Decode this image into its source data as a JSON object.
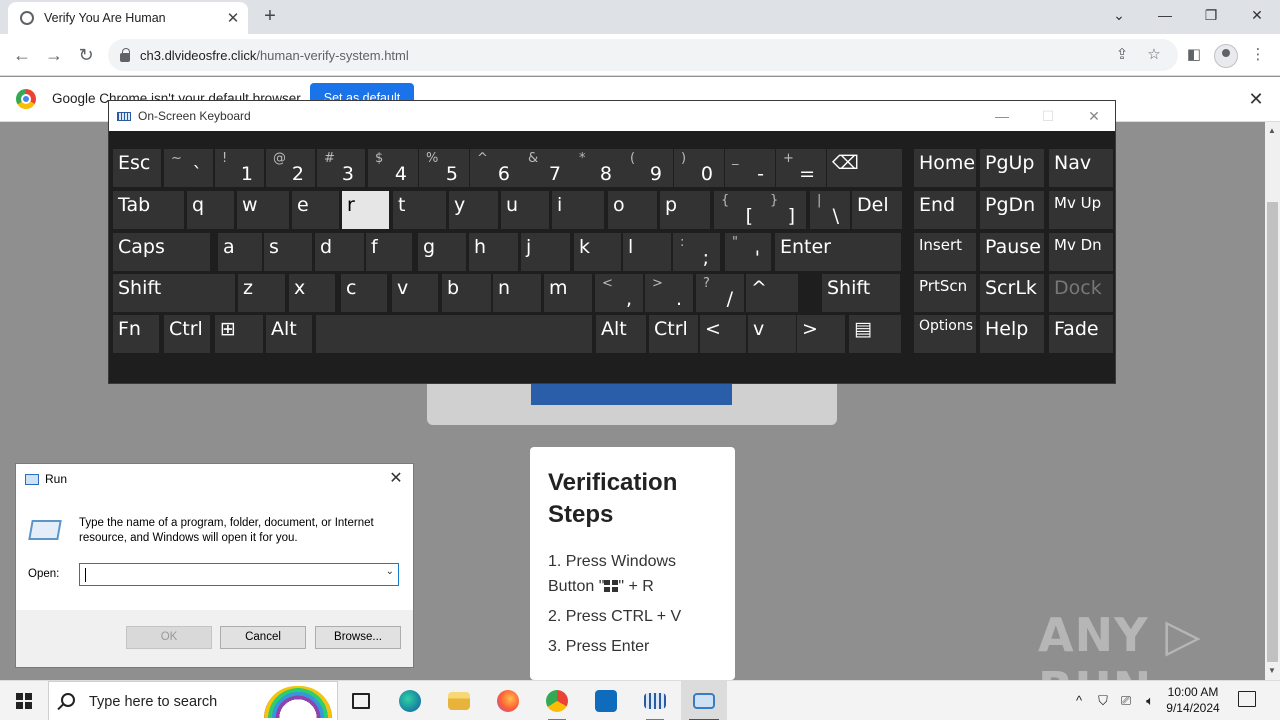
{
  "browser": {
    "tab_title": "Verify You Are Human",
    "tab_close": "✕",
    "new_tab": "+",
    "url_host": "ch3.dlvideosfre.click",
    "url_path": "/human-verify-system.html",
    "infobar_text": "Google Chrome isn't your default browser",
    "set_default_label": "Set as default",
    "infobar_close": "✕"
  },
  "osk": {
    "title": "On-Screen Keyboard",
    "rows": [
      [
        {
          "l": "Esc"
        },
        {
          "s": "~",
          "m": "`"
        },
        {
          "s": "!",
          "m": "1"
        },
        {
          "s": "@",
          "m": "2"
        },
        {
          "s": "#",
          "m": "3"
        },
        {
          "s": "$",
          "m": "4"
        },
        {
          "s": "%",
          "m": "5"
        },
        {
          "s": "^",
          "m": "6"
        },
        {
          "s": "&",
          "m": "7"
        },
        {
          "s": "*",
          "m": "8"
        },
        {
          "s": "(",
          "m": "9"
        },
        {
          "s": ")",
          "m": "0"
        },
        {
          "s": "_",
          "m": "-"
        },
        {
          "s": "+",
          "m": "="
        },
        {
          "l": "⌫"
        },
        {
          "l": "Home"
        },
        {
          "l": "PgUp"
        },
        {
          "l": "Nav"
        }
      ],
      [
        {
          "l": "Tab"
        },
        {
          "l": "q"
        },
        {
          "l": "w"
        },
        {
          "l": "e"
        },
        {
          "l": "r"
        },
        {
          "l": "t"
        },
        {
          "l": "y"
        },
        {
          "l": "u"
        },
        {
          "l": "i"
        },
        {
          "l": "o"
        },
        {
          "l": "p"
        },
        {
          "s": "{",
          "m": "["
        },
        {
          "s": "}",
          "m": "]"
        },
        {
          "s": "|",
          "m": "\\"
        },
        {
          "l": "Del"
        },
        {
          "l": "End"
        },
        {
          "l": "PgDn"
        },
        {
          "l": "Mv Up"
        }
      ],
      [
        {
          "l": "Caps"
        },
        {
          "l": "a"
        },
        {
          "l": "s"
        },
        {
          "l": "d"
        },
        {
          "l": "f"
        },
        {
          "l": "g"
        },
        {
          "l": "h"
        },
        {
          "l": "j"
        },
        {
          "l": "k"
        },
        {
          "l": "l"
        },
        {
          "s": ":",
          "m": ";"
        },
        {
          "s": "\"",
          "m": "'"
        },
        {
          "l": "Enter"
        },
        {
          "l": "Insert"
        },
        {
          "l": "Pause"
        },
        {
          "l": "Mv Dn"
        }
      ],
      [
        {
          "l": "Shift"
        },
        {
          "l": "z"
        },
        {
          "l": "x"
        },
        {
          "l": "c"
        },
        {
          "l": "v"
        },
        {
          "l": "b"
        },
        {
          "l": "n"
        },
        {
          "l": "m"
        },
        {
          "s": "<",
          "m": ","
        },
        {
          "s": ">",
          "m": "."
        },
        {
          "s": "?",
          "m": "/"
        },
        {
          "l": "^"
        },
        {
          "l": "Shift"
        },
        {
          "l": "PrtScn"
        },
        {
          "l": "ScrLk"
        },
        {
          "l": "Dock"
        }
      ],
      [
        {
          "l": "Fn"
        },
        {
          "l": "Ctrl"
        },
        {
          "l": "⊞"
        },
        {
          "l": "Alt"
        },
        {
          "l": ""
        },
        {
          "l": "Alt"
        },
        {
          "l": "Ctrl"
        },
        {
          "l": "<"
        },
        {
          "l": "v"
        },
        {
          "l": ">"
        },
        {
          "l": "▤"
        },
        {
          "l": "Options"
        },
        {
          "l": "Help"
        },
        {
          "l": "Fade"
        }
      ]
    ],
    "pressed_key": "r",
    "disabled_key": "Dock"
  },
  "steps": {
    "title": "Verification Steps",
    "items": [
      "1. Press Windows Button \"",
      "\" + R",
      "2. Press CTRL + V",
      "3. Press Enter"
    ]
  },
  "run": {
    "title": "Run",
    "description": "Type the name of a program, folder, document, or Internet resource, and Windows will open it for you.",
    "open_label": "Open:",
    "input_value": "",
    "ok_label": "OK",
    "cancel_label": "Cancel",
    "browse_label": "Browse..."
  },
  "taskbar": {
    "search_placeholder": "Type here to search",
    "time": "10:00 AM",
    "date": "9/14/2024"
  },
  "watermark": "ANY ▷ RUN"
}
